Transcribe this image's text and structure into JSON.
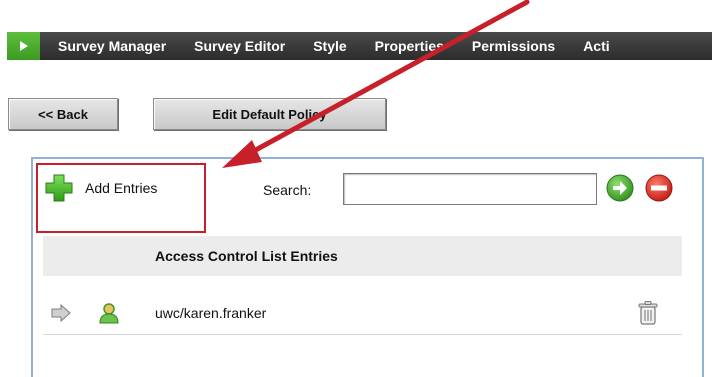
{
  "nav": {
    "items": [
      {
        "label": "Survey Manager"
      },
      {
        "label": "Survey Editor"
      },
      {
        "label": "Style"
      },
      {
        "label": "Properties"
      },
      {
        "label": "Permissions"
      },
      {
        "label": "Acti"
      }
    ]
  },
  "toolbar": {
    "back_label": "<< Back",
    "edit_policy_label": "Edit Default Policy"
  },
  "panel": {
    "add_entries_label": "Add Entries",
    "search_label": "Search:",
    "search_value": "",
    "table_header": "Access Control List Entries",
    "entries": [
      {
        "name": "uwc/karen.franker"
      }
    ]
  },
  "colors": {
    "nav_bg": "#333333",
    "nav_toggle": "#4caf2e",
    "highlight": "#c8202a",
    "panel_border": "#8fb2d6",
    "add_icon": "#3cb521",
    "go_icon": "#3aa629",
    "cancel_icon": "#d8231d"
  },
  "icons": {
    "add": "plus-icon",
    "go": "go-arrow-icon",
    "cancel": "cancel-icon",
    "row_arrow": "right-arrow-icon",
    "user": "user-icon",
    "delete": "trash-icon"
  }
}
